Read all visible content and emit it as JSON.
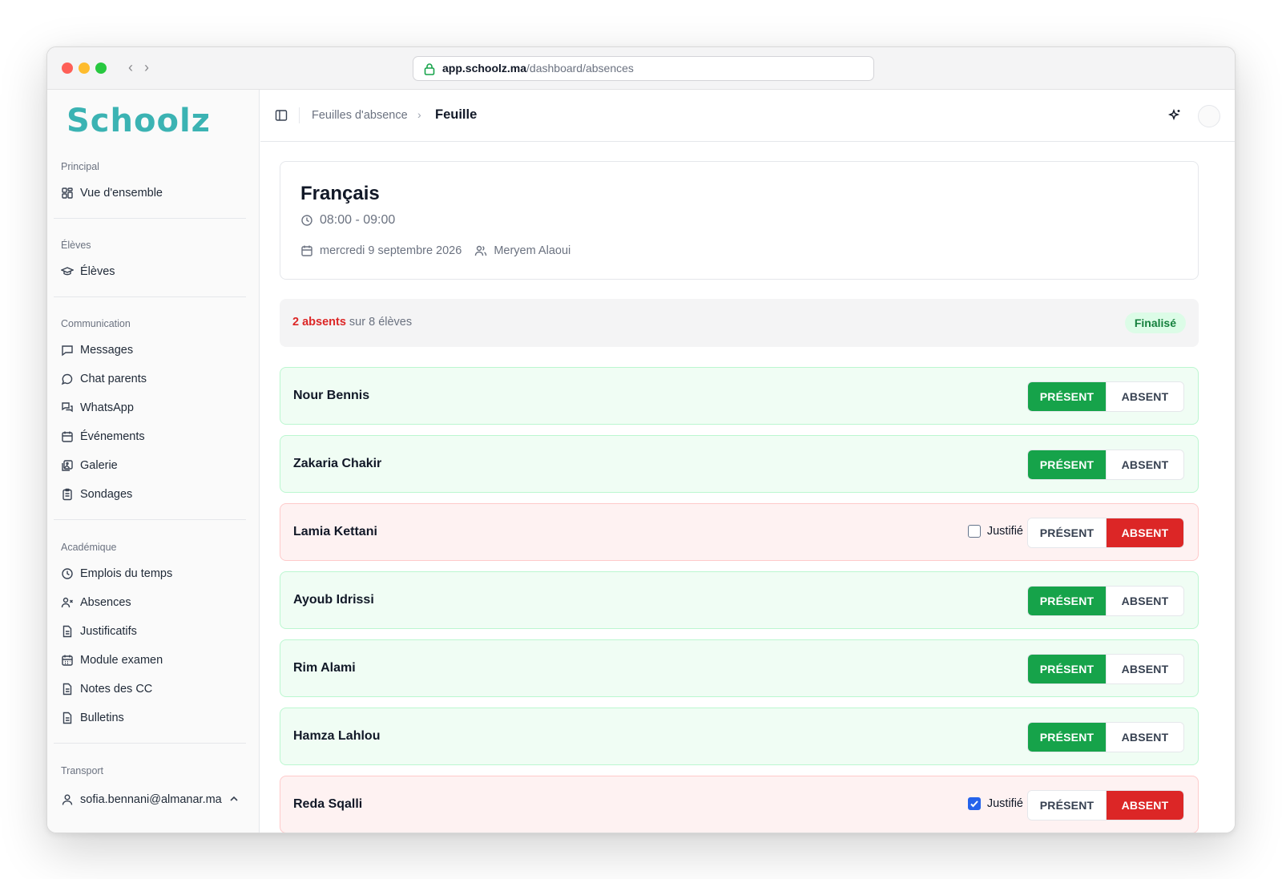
{
  "browser": {
    "url_domain": "app.schoolz.ma",
    "url_path": "/dashboard/absences"
  },
  "sidebar": {
    "logo": "Schoolz",
    "sections": {
      "principal": "Principal",
      "eleves": "Élèves",
      "communication": "Communication",
      "academique": "Académique",
      "transport": "Transport"
    },
    "items": {
      "overview": "Vue d'ensemble",
      "eleves": "Élèves",
      "messages": "Messages",
      "chat_parents": "Chat parents",
      "whatsapp": "WhatsApp",
      "evenements": "Événements",
      "galerie": "Galerie",
      "sondages": "Sondages",
      "emplois": "Emplois du temps",
      "absences": "Absences",
      "justificatifs": "Justificatifs",
      "module_examen": "Module examen",
      "notes_cc": "Notes des CC",
      "bulletins": "Bulletins"
    },
    "user_email": "sofia.bennani@almanar.ma"
  },
  "header": {
    "breadcrumb_parent": "Feuilles d'absence",
    "breadcrumb_current": "Feuille"
  },
  "sheet": {
    "subject": "Français",
    "time": "08:00 - 09:00",
    "date": "mercredi 9 septembre 2026",
    "teacher": "Meryem Alaoui"
  },
  "summary": {
    "absent_count": "2 absents",
    "total_text": " sur 8 élèves",
    "status": "Finalisé"
  },
  "labels": {
    "present": "PRÉSENT",
    "absent": "ABSENT",
    "justified": "Justifié"
  },
  "students": [
    {
      "name": "Nour Bennis",
      "status": "present"
    },
    {
      "name": "Zakaria Chakir",
      "status": "present"
    },
    {
      "name": "Lamia Kettani",
      "status": "absent",
      "justified": false
    },
    {
      "name": "Ayoub Idrissi",
      "status": "present"
    },
    {
      "name": "Rim Alami",
      "status": "present"
    },
    {
      "name": "Hamza Lahlou",
      "status": "present"
    },
    {
      "name": "Reda Sqalli",
      "status": "absent",
      "justified": true
    }
  ],
  "colors": {
    "present": "#16a34a",
    "absent": "#dc2626",
    "logo": "#3bb3b3"
  }
}
